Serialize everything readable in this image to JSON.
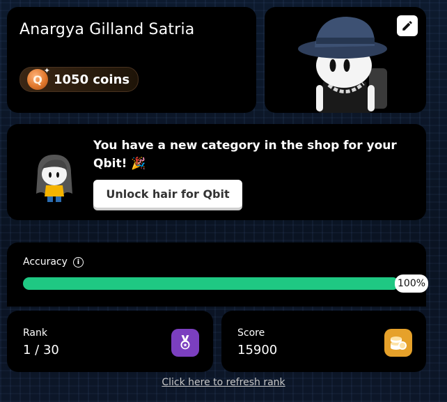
{
  "profile": {
    "name": "Anargya Gilland Satria",
    "coins_label": "1050 coins",
    "coin_symbol": "Q"
  },
  "avatar_card": {
    "edit_icon": "pencil-icon"
  },
  "promo": {
    "message": "You have a new category in the shop for your Qbit! 🎉",
    "button_label": "Unlock hair for Qbit"
  },
  "accuracy": {
    "label": "Accuracy",
    "info_symbol": "i",
    "value_percent": 100,
    "value_label": "100%",
    "bar_color": "#1fc883"
  },
  "rank": {
    "label": "Rank",
    "value": "1 / 30",
    "icon": "medal-icon",
    "icon_color": "#7b3fbf"
  },
  "score": {
    "label": "Score",
    "value": "15900",
    "icon": "coin-stack-icon",
    "icon_color": "#e6a12a"
  },
  "footer": {
    "refresh_link": "Click here to refresh rank"
  }
}
